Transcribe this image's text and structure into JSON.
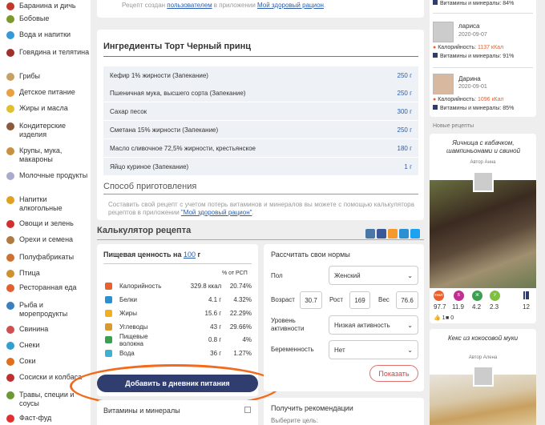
{
  "sidebar": {
    "items": [
      {
        "label": "Баранина и дичь",
        "icon": "meat-icon",
        "color": "#c0392b"
      },
      {
        "label": "Бобовые",
        "icon": "beans-icon",
        "color": "#7a9a2a"
      },
      {
        "label": "Вода и напитки",
        "icon": "drink-icon",
        "color": "#3498db"
      },
      {
        "label": "Говядина и телятина",
        "icon": "beef-icon",
        "color": "#a0302a"
      },
      {
        "label": "Грибы",
        "icon": "mushroom-icon",
        "color": "#c8a060"
      },
      {
        "label": "Детское питание",
        "icon": "baby-food-icon",
        "color": "#e8a040"
      },
      {
        "label": "Жиры и масла",
        "icon": "oil-icon",
        "color": "#e0c030"
      },
      {
        "label": "Кондитерские изделия",
        "icon": "cake-icon",
        "color": "#8a5a3a"
      },
      {
        "label": "Крупы, мука, макароны",
        "icon": "grain-icon",
        "color": "#c89040"
      },
      {
        "label": "Молочные продукты",
        "icon": "milk-icon",
        "color": "#aaaacc"
      },
      {
        "label": "Напитки алкогольные",
        "icon": "wine-icon",
        "color": "#e0a020"
      },
      {
        "label": "Овощи и зелень",
        "icon": "vegetable-icon",
        "color": "#d03030"
      },
      {
        "label": "Орехи и семена",
        "icon": "nut-icon",
        "color": "#b07a40"
      },
      {
        "label": "Полуфабрикаты",
        "icon": "semi-product-icon",
        "color": "#d07030"
      },
      {
        "label": "Птица",
        "icon": "poultry-icon",
        "color": "#d09030"
      },
      {
        "label": "Ресторанная еда",
        "icon": "restaurant-icon",
        "color": "#e06030"
      },
      {
        "label": "Рыба и морепродукты",
        "icon": "fish-icon",
        "color": "#3a80c0"
      },
      {
        "label": "Свинина",
        "icon": "pork-icon",
        "color": "#d05050"
      },
      {
        "label": "Снеки",
        "icon": "snack-icon",
        "color": "#30a0d0"
      },
      {
        "label": "Соки",
        "icon": "juice-icon",
        "color": "#e07020"
      },
      {
        "label": "Сосиски и колбаса",
        "icon": "sausage-icon",
        "color": "#c03030"
      },
      {
        "label": "Травы, специи и соусы",
        "icon": "herbs-icon",
        "color": "#6a9a30"
      },
      {
        "label": "Фаст-фуд",
        "icon": "fastfood-icon",
        "color": "#e03030"
      }
    ]
  },
  "recipe_info": {
    "prefix": "Рецепт создан ",
    "link1": "пользователем",
    "middle": " в приложении ",
    "link2": "Мой здоровый рацион",
    "suffix": "."
  },
  "ingredients": {
    "title": "Ингредиенты Торт Черный принц",
    "rows": [
      {
        "name": "Кефир 1% жирности (Запекание)",
        "amount": "250 г"
      },
      {
        "name": "Пшеничная мука, высшего сорта (Запекание)",
        "amount": "250 г"
      },
      {
        "name": "Сахар песок",
        "amount": "300 г"
      },
      {
        "name": "Сметана 15% жирности (Запекание)",
        "amount": "250 г"
      },
      {
        "name": "Масло сливочное 72,5% жирности, крестьянское",
        "amount": "180 г"
      },
      {
        "name": "Яйцо куриное (Запекание)",
        "amount": "1 г"
      }
    ]
  },
  "prep": {
    "title": "Способ приготовления",
    "text1": "Составить свой рецепт с учетом потерь витаминов и минералов вы можете с помощью калькулятора рецептов в приложении ",
    "link": "\"Мой здоровый рацион\"",
    "text2": "."
  },
  "calculator": {
    "title": "Калькулятор рецепта"
  },
  "nutrition": {
    "title_prefix": "Пищевая ценность на ",
    "title_link": "100",
    "title_suffix": " г",
    "col_header": "% от РСП",
    "rows": [
      {
        "name": "Калорийность",
        "value": "329.8 ккал",
        "pct": "20.74%",
        "icon": "fire-icon",
        "color": "#e8602c"
      },
      {
        "name": "Белки",
        "value": "4.1 г",
        "pct": "4.32%",
        "icon": "protein-icon",
        "color": "#2a90d0"
      },
      {
        "name": "Жиры",
        "value": "15.6 г",
        "pct": "22.29%",
        "icon": "fat-icon",
        "color": "#f0b020"
      },
      {
        "name": "Углеводы",
        "value": "43 г",
        "pct": "29.66%",
        "icon": "carbs-icon",
        "color": "#d89a30"
      },
      {
        "name": "Пищевые волокна",
        "value": "0.8 г",
        "pct": "4%",
        "icon": "fiber-icon",
        "color": "#3aa050"
      },
      {
        "name": "Вода",
        "value": "36 г",
        "pct": "1.27%",
        "icon": "water-icon",
        "color": "#40b0d0"
      }
    ],
    "add_button": "Добавить в дневник питания",
    "vitamins": "Витамины и минералы"
  },
  "norms": {
    "title": "Рассчитать свои нормы",
    "sex_label": "Пол",
    "sex_value": "Женский",
    "age_label": "Возраст",
    "age_value": "30.7",
    "height_label": "Рост",
    "height_value": "169",
    "weight_label": "Вес",
    "weight_value": "76.6",
    "activity_label": "Уровень активности",
    "activity_value": "Низкая активность",
    "pregnancy_label": "Беременность",
    "pregnancy_value": "Нет",
    "show_button": "Показать"
  },
  "recommendations": {
    "title": "Получить рекомендации",
    "sub": "Выберите цель:"
  },
  "right": {
    "top_vit": "Витамины и минералы: 84%",
    "users": [
      {
        "name": "лариса",
        "date": "2020-09-07",
        "cal_label": "Калорийность: ",
        "cal": "1137 кКал",
        "vit": "Витамины и минералы: 91%"
      },
      {
        "name": "Дарина",
        "date": "2020-09-01",
        "cal_label": "Калорийность: ",
        "cal": "1096 кКал",
        "vit": "Витамины и минералы: 85%"
      }
    ],
    "new_recipes": "Новые рецепты",
    "recipe1": {
      "title": "Яичница с кабачком, шампиньонами и свиной",
      "author": "Автор Анна",
      "stats": [
        "97.7",
        "11.9",
        "4.2",
        "2.3",
        "12"
      ],
      "likes": "1",
      "comments": "0"
    },
    "recipe2": {
      "title": "Кекс из кокосовой муки",
      "author": "Автор Алена"
    }
  }
}
